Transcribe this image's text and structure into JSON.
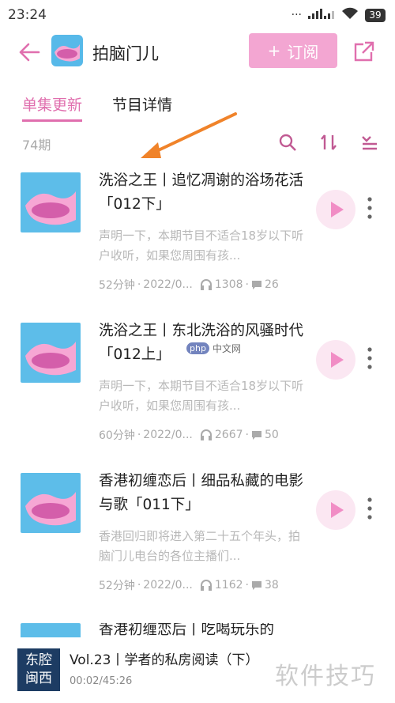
{
  "status_bar": {
    "time": "23:24",
    "battery": "39"
  },
  "header": {
    "title": "拍脑门儿",
    "subscribe_label": "订阅"
  },
  "tabs": [
    {
      "label": "单集更新",
      "active": true
    },
    {
      "label": "节目详情",
      "active": false
    }
  ],
  "episode_count": "74期",
  "episodes": [
    {
      "title": "洗浴之王丨追忆凋谢的浴场花活「012下」",
      "description": "声明一下，本期节目不适合18岁以下听户收听，如果您周围有孩...",
      "duration": "52分钟",
      "date": "2022/0...",
      "plays": "1308",
      "comments": "26"
    },
    {
      "title": "洗浴之王丨东北洗浴的风骚时代「012上」",
      "description": "声明一下，本期节目不适合18岁以下听户收听，如果您周围有孩...",
      "duration": "60分钟",
      "date": "2022/0...",
      "plays": "2667",
      "comments": "50"
    },
    {
      "title": "香港初缠恋后丨细品私藏的电影与歌「011下」",
      "description": "香港回归即将进入第二十五个年头，拍脑门儿电台的各位主播们...",
      "duration": "52分钟",
      "date": "2022/0...",
      "plays": "1162",
      "comments": "38"
    },
    {
      "title": "香港初缠恋后丨吃喝玩乐的",
      "description": "",
      "duration": "",
      "date": "",
      "plays": "",
      "comments": ""
    }
  ],
  "player": {
    "cover_text_1": "东腔",
    "cover_text_2": "闽西",
    "title": "Vol.23丨学者的私房阅读（下）",
    "time": "00:02/45:26"
  },
  "watermark": "软件技巧",
  "watermark_php": "php",
  "watermark_site": "中文网",
  "colors": {
    "accent": "#e06fae",
    "subscribe_bg": "#f3a6d2",
    "play_bg": "#fbe7f2",
    "annotation_arrow": "#f0832a"
  }
}
